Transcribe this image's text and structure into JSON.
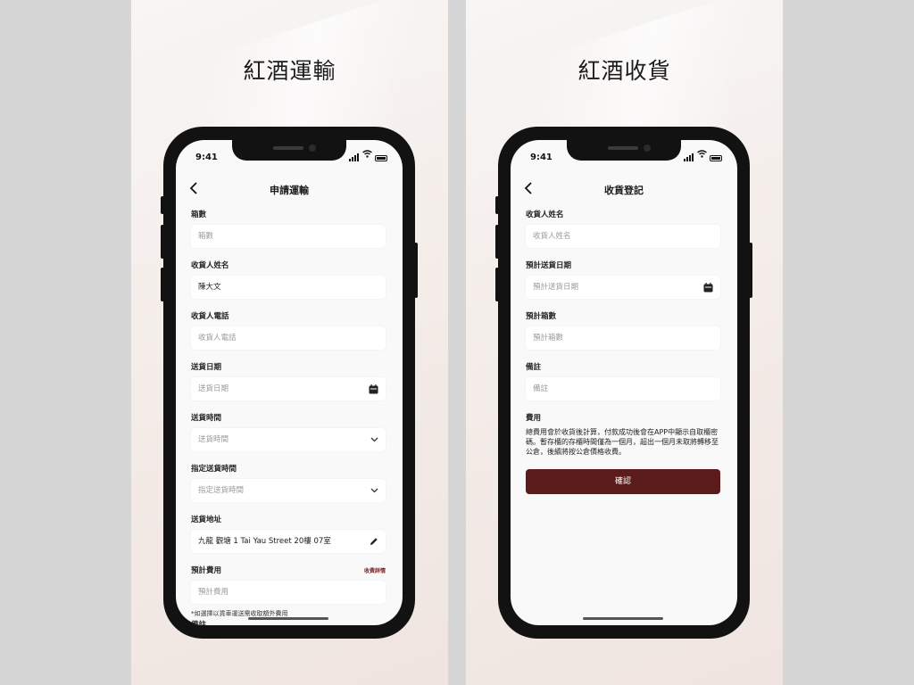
{
  "left": {
    "panel_title": "紅酒運輸",
    "status_time": "9:41",
    "nav_title": "申請運輸",
    "fields": {
      "boxes": {
        "label": "箱數",
        "placeholder": "箱數"
      },
      "recipient_name": {
        "label": "收貨人姓名",
        "value": "陳大文"
      },
      "recipient_phone": {
        "label": "收貨人電話",
        "placeholder": "收貨人電話"
      },
      "delivery_date": {
        "label": "送貨日期",
        "placeholder": "送貨日期",
        "icon": "calendar-icon"
      },
      "delivery_time": {
        "label": "送貨時間",
        "placeholder": "送貨時間",
        "icon": "chevron-down-icon"
      },
      "specified_time": {
        "label": "指定送貨時間",
        "placeholder": "指定送貨時間",
        "icon": "chevron-down-icon"
      },
      "address": {
        "label": "送貨地址",
        "value": "九龍 觀塘 1 Tai Yau Street 20樓 07室",
        "icon": "edit-icon"
      },
      "estimated_fee": {
        "label": "預計費用",
        "placeholder": "預計費用",
        "link": "收費詳情"
      },
      "remarks_label": "備註"
    },
    "note": "*如選擇以貨車運送需收取額外費用"
  },
  "right": {
    "panel_title": "紅酒收貨",
    "status_time": "9:41",
    "nav_title": "收貨登記",
    "fields": {
      "recipient_name": {
        "label": "收貨人姓名",
        "placeholder": "收貨人姓名"
      },
      "expected_date": {
        "label": "預計送貨日期",
        "placeholder": "預計送貨日期",
        "icon": "calendar-icon"
      },
      "expected_boxes": {
        "label": "預計箱數",
        "placeholder": "預計箱數"
      },
      "remarks": {
        "label": "備註",
        "placeholder": "備註"
      }
    },
    "fee_label": "費用",
    "fee_text": "總費用會於收貨後計算，付款成功後會在APP中顯示自取櫃密碼。暫存櫃的存櫃時間僅為一個月，超出一個月未取將轉移至公倉，後續將按公倉價格收費。",
    "confirm_label": "確認"
  },
  "colors": {
    "accent": "#5c1c1c",
    "link": "#7b1e1e"
  }
}
